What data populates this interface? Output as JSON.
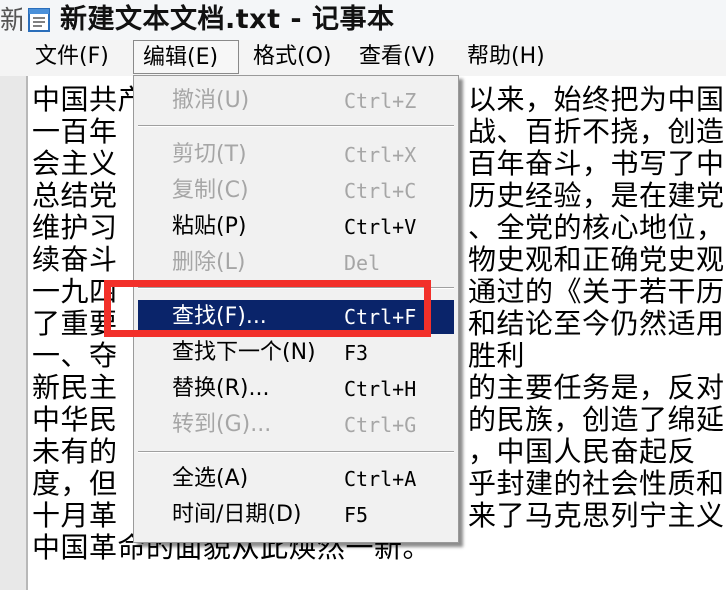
{
  "window": {
    "title": "新建文本文档.txt - 记事本",
    "partial_left_char": "新"
  },
  "menubar": {
    "items": [
      {
        "label": "文件(F)"
      },
      {
        "label": "编辑(E)"
      },
      {
        "label": "格式(O)"
      },
      {
        "label": "查看(V)"
      },
      {
        "label": "帮助(H)"
      }
    ]
  },
  "edit_menu": {
    "items": [
      {
        "label": "撤消(U)",
        "shortcut": "Ctrl+Z",
        "enabled": false
      },
      {
        "label": "剪切(T)",
        "shortcut": "Ctrl+X",
        "enabled": false
      },
      {
        "label": "复制(C)",
        "shortcut": "Ctrl+C",
        "enabled": false
      },
      {
        "label": "粘贴(P)",
        "shortcut": "Ctrl+V",
        "enabled": true
      },
      {
        "label": "删除(L)",
        "shortcut": "Del",
        "enabled": false
      },
      {
        "label": "查找(F)...",
        "shortcut": "Ctrl+F",
        "enabled": true,
        "selected": true
      },
      {
        "label": "查找下一个(N)",
        "shortcut": "F3",
        "enabled": true
      },
      {
        "label": "替换(R)...",
        "shortcut": "Ctrl+H",
        "enabled": true
      },
      {
        "label": "转到(G)...",
        "shortcut": "Ctrl+G",
        "enabled": false
      },
      {
        "label": "全选(A)",
        "shortcut": "Ctrl+A",
        "enabled": true
      },
      {
        "label": "时间/日期(D)",
        "shortcut": "F5",
        "enabled": true
      }
    ]
  },
  "editor": {
    "lines": [
      "中国共产",
      "一百年",
      "会主义",
      "总结党",
      "维护习",
      "续奋斗",
      "一九四",
      "了重要",
      "一、夺",
      "新民主",
      "中华民",
      "未有的",
      "度，但",
      "十月革",
      "中国革命的面貌从此焕然一新。"
    ],
    "lines_right": [
      "以来，始终把为中国",
      "战、百折不挠，创造",
      "百年奋斗，书写了中",
      "历史经验，是在建党",
      "、全党的核心地位，",
      "物史观和正确党史观",
      "通过的《关于若干历",
      "和结论至今仍然适用",
      "胜利",
      "的主要任务是，反对",
      "的民族，创造了绵延",
      "，中国人民奋起反",
      "乎封建的社会性质和",
      "来了马克思列宁主义",
      ""
    ]
  },
  "colors": {
    "selection": "#0a246a",
    "highlight_border": "#f2302a",
    "disabled_text": "#a6a6a6"
  }
}
